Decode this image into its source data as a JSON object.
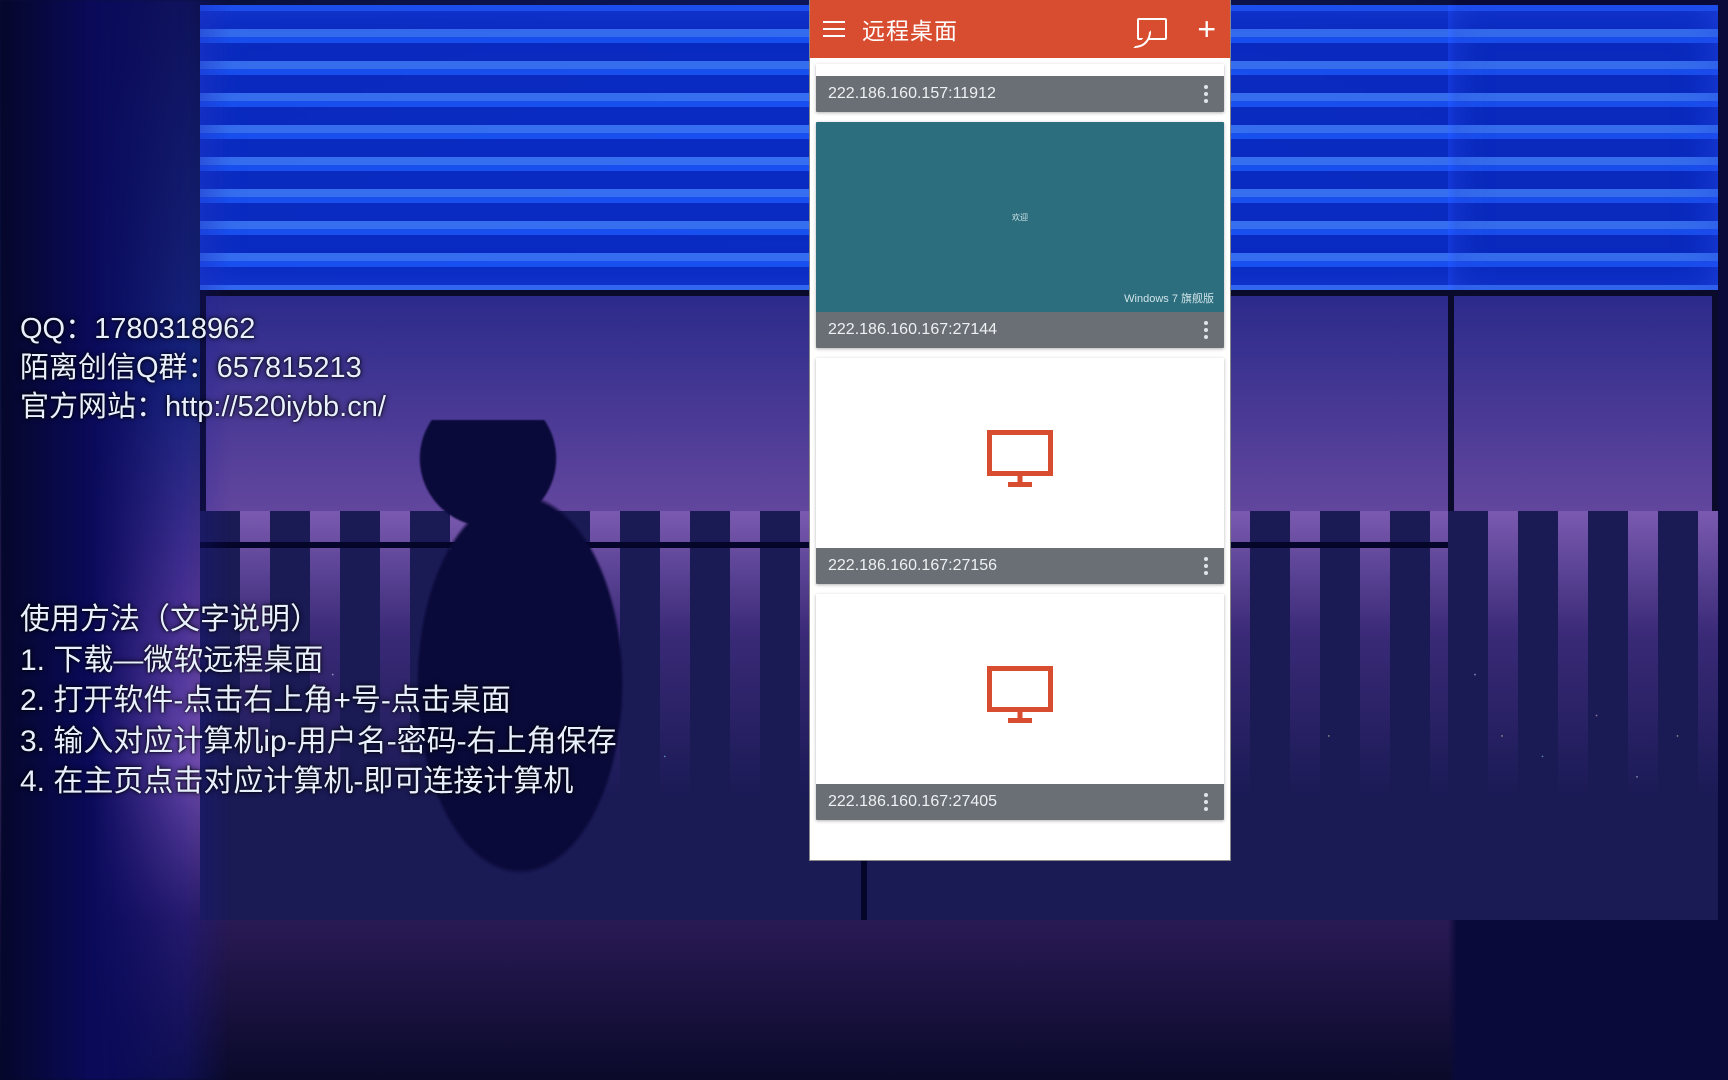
{
  "contact": {
    "qq_label": "QQ：",
    "qq_value": "1780318962",
    "group_label": "陌离创信Q群：",
    "group_value": "657815213",
    "site_label": "官方网站：",
    "site_value": "http://520iybb.cn/"
  },
  "steps": {
    "heading": "使用方法（文字说明）",
    "items": [
      "1.  下载—微软远程桌面",
      "2.  打开软件-点击右上角+号-点击桌面",
      "3.  输入对应计算机ip-用户名-密码-右上角保存",
      "4.  在主页点击对应计算机-即可连接计算机"
    ]
  },
  "phone": {
    "app_title": "远程桌面",
    "preview_welcome": "欢迎",
    "win7_caption": "Windows 7 旗舰版",
    "connections": [
      {
        "address": "222.186.160.157:11912",
        "preview": "short"
      },
      {
        "address": "222.186.160.167:27144",
        "preview": "teal"
      },
      {
        "address": "222.186.160.167:27156",
        "preview": "icon"
      },
      {
        "address": "222.186.160.167:27405",
        "preview": "icon"
      }
    ]
  }
}
